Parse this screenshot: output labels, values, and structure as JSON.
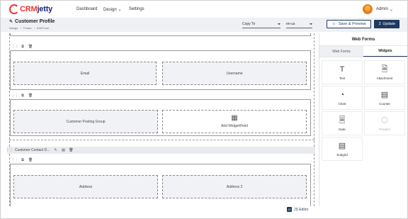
{
  "topbar": {
    "logo_prefix": "CRM",
    "logo_suffix": "jetty",
    "nav": [
      "Dashboard",
      "Design",
      "Settings"
    ],
    "user": "Admin"
  },
  "header": {
    "title": "Customer Profile",
    "breadcrumb": [
      "Design",
      "Forms",
      "Edit Form"
    ],
    "copy_to_label": "Copy To",
    "locale": "en-us",
    "save_preview": "Save & Preview",
    "update": "Update"
  },
  "canvas": {
    "fields": {
      "email": "Email",
      "username": "Username",
      "customer_posting_group": "Customer Posting Group",
      "add_widget": "Add Widget/Field",
      "address": "Address",
      "address2": "Address 2"
    },
    "section_name": "Customer Contact D...",
    "js_editor": "JS Editor"
  },
  "panel": {
    "title": "Web Forms",
    "tabs": [
      "Web Forms",
      "Widgets"
    ],
    "active_tab": "Widgets",
    "widgets": [
      {
        "label": "Text",
        "icon": "text-icon",
        "enabled": true
      },
      {
        "label": "Attachment",
        "icon": "attachment-icon",
        "enabled": true
      },
      {
        "label": "Chart",
        "icon": "chart-icon",
        "enabled": true
      },
      {
        "label": "Counter",
        "icon": "counter-icon",
        "enabled": true
      },
      {
        "label": "Note",
        "icon": "note-icon",
        "enabled": true
      },
      {
        "label": "Product",
        "icon": "product-icon",
        "enabled": false
      },
      {
        "label": "Subgrid",
        "icon": "subgrid-icon",
        "enabled": true
      }
    ]
  },
  "colors": {
    "brand_red": "#e53935",
    "brand_navy": "#1e3a5f"
  }
}
